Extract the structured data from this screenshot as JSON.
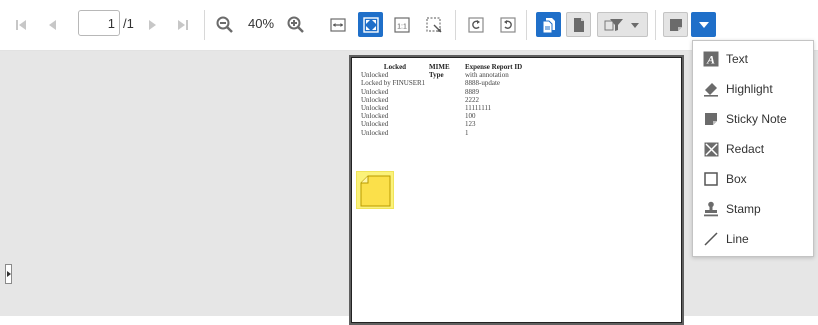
{
  "toolbar": {
    "page_current": "1",
    "page_total": "/1",
    "zoom": "40%",
    "icons": {
      "first_page": "first-page-icon",
      "prev_page": "previous-page-icon",
      "next_page": "next-page-icon",
      "last_page": "last-page-icon",
      "zoom_out": "zoom-out-icon",
      "zoom_in": "zoom-in-icon",
      "fit_width": "fit-width-icon",
      "fit_page": "fit-page-icon",
      "actual_size": "actual-size-icon",
      "marquee_zoom": "marquee-zoom-icon",
      "rotate_left": "rotate-left-icon",
      "rotate_right": "rotate-right-icon"
    },
    "accent_color": "#1f6fc9"
  },
  "document": {
    "headers": [
      "Locked",
      "MIME Type",
      "Expense Report ID"
    ],
    "rows": [
      [
        "Unlocked",
        "",
        "with annotation"
      ],
      [
        "Locked by FINUSER1",
        "",
        "8888-update"
      ],
      [
        "Unlocked",
        "",
        "8889"
      ],
      [
        "Unlocked",
        "",
        "2222"
      ],
      [
        "Unlocked",
        "",
        "11111111"
      ],
      [
        "Unlocked",
        "",
        "100"
      ],
      [
        "Unlocked",
        "",
        "123"
      ],
      [
        "Unlocked",
        "",
        "1"
      ]
    ],
    "sticky_note_color": "#fbf27a"
  },
  "annotation_menu": {
    "items": [
      {
        "label": "Text",
        "icon": "text-annotation-icon"
      },
      {
        "label": "Highlight",
        "icon": "highlight-icon"
      },
      {
        "label": "Sticky Note",
        "icon": "sticky-note-icon"
      },
      {
        "label": "Redact",
        "icon": "redact-icon"
      },
      {
        "label": "Box",
        "icon": "box-icon"
      },
      {
        "label": "Stamp",
        "icon": "stamp-icon"
      },
      {
        "label": "Line",
        "icon": "line-icon"
      }
    ]
  }
}
